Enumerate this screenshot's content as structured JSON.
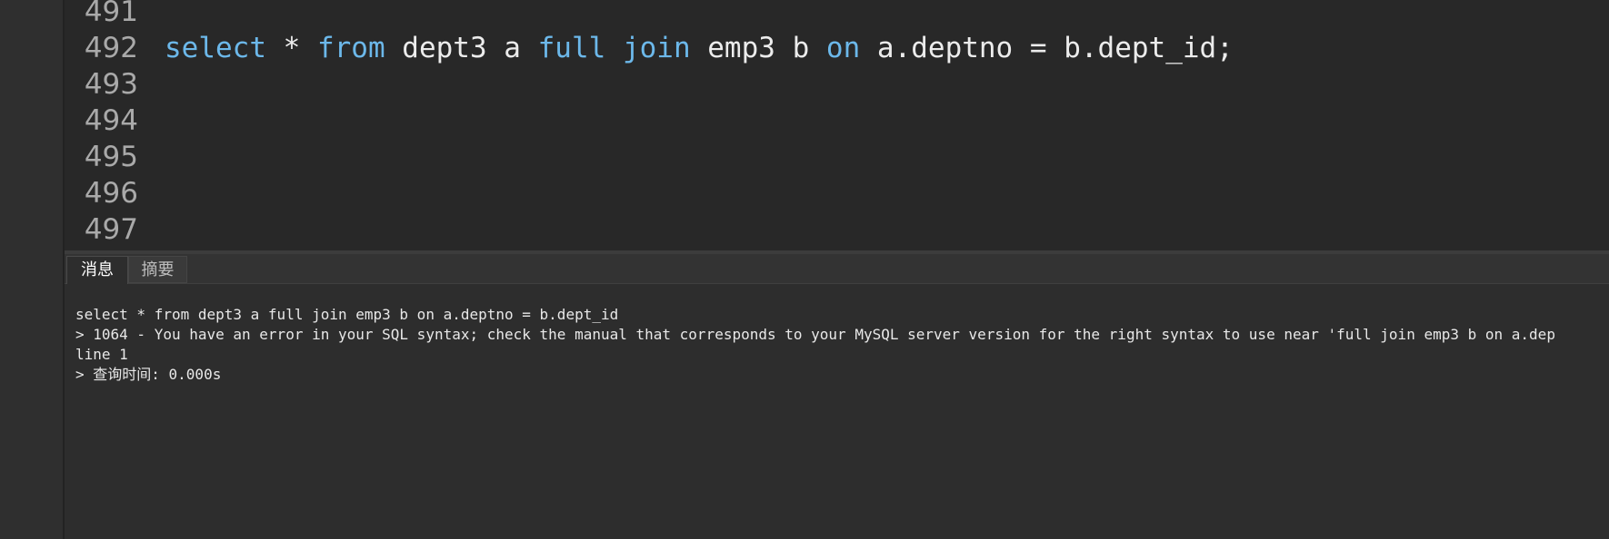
{
  "editor": {
    "lines": [
      {
        "number": "491",
        "tokens": []
      },
      {
        "number": "492",
        "tokens": [
          {
            "text": "select",
            "type": "keyword"
          },
          {
            "text": " * ",
            "type": "plain"
          },
          {
            "text": "from",
            "type": "keyword"
          },
          {
            "text": " dept3 a ",
            "type": "plain"
          },
          {
            "text": "full",
            "type": "keyword"
          },
          {
            "text": " ",
            "type": "plain"
          },
          {
            "text": "join",
            "type": "keyword"
          },
          {
            "text": " emp3 b ",
            "type": "plain"
          },
          {
            "text": "on",
            "type": "keyword"
          },
          {
            "text": " a.deptno = b.dept_id;",
            "type": "plain"
          }
        ]
      },
      {
        "number": "493",
        "tokens": []
      },
      {
        "number": "494",
        "tokens": []
      },
      {
        "number": "495",
        "tokens": []
      },
      {
        "number": "496",
        "tokens": []
      },
      {
        "number": "497",
        "tokens": []
      }
    ]
  },
  "bottom_panel": {
    "tabs": [
      {
        "label": "消息",
        "active": true
      },
      {
        "label": "摘要",
        "active": false
      }
    ],
    "messages": [
      "select * from dept3 a full join emp3 b on a.deptno = b.dept_id",
      "> 1064 - You have an error in your SQL syntax; check the manual that corresponds to your MySQL server version for the right syntax to use near 'full join emp3 b on a.dep",
      "line 1",
      "> 查询时间: 0.000s"
    ]
  },
  "colors": {
    "keyword": "#6cb8ea",
    "plain_text": "#ececec",
    "line_number": "#a9a9a9",
    "editor_background": "#282828",
    "panel_background": "#2d2d2d"
  }
}
